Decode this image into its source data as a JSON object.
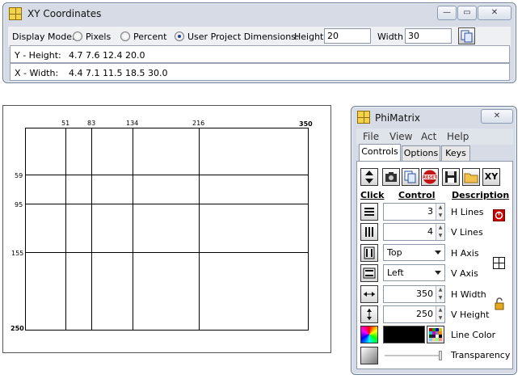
{
  "xy_window": {
    "title": "XY Coordinates",
    "display_mode_label": "Display Mode:",
    "modes": [
      "Pixels",
      "Percent",
      "User Project Dimensions:"
    ],
    "selected_mode": "User Project Dimensions:",
    "height_label": "Height",
    "height_value": "20",
    "width_label": "Width",
    "width_value": "30",
    "y_label": "Y - Height:",
    "y_values": "4.7  7.6  12.4  20.0",
    "x_label": "X - Width:",
    "x_values": "4.4  7.1  11.5  18.5  30.0"
  },
  "canvas": {
    "x_ticks": [
      "51",
      "83",
      "134",
      "216",
      "350"
    ],
    "y_ticks": [
      "59",
      "95",
      "155",
      "250"
    ],
    "line_color": "#000000"
  },
  "phimatrix": {
    "title": "PhiMatrix",
    "menu": [
      "File",
      "View",
      "Act",
      "Help"
    ],
    "tabs": [
      "Controls",
      "Options",
      "Keys"
    ],
    "active_tab": "Controls",
    "toolbar": {
      "reset_label": "RESET",
      "xy_label": "XY"
    },
    "headers": {
      "click": "Click",
      "control": "Control",
      "description": "Description"
    },
    "rows": [
      {
        "value": "3",
        "description": "H Lines"
      },
      {
        "value": "4",
        "description": "V Lines"
      },
      {
        "value": "Top",
        "description": "H Axis"
      },
      {
        "value": "Left",
        "description": "V Axis"
      },
      {
        "value": "350",
        "description": "H Width"
      },
      {
        "value": "250",
        "description": "V Height"
      },
      {
        "value": "",
        "description": "Line Color"
      },
      {
        "value": "",
        "description": "Transparency"
      }
    ],
    "accent_stop_color": "#cc0000"
  }
}
